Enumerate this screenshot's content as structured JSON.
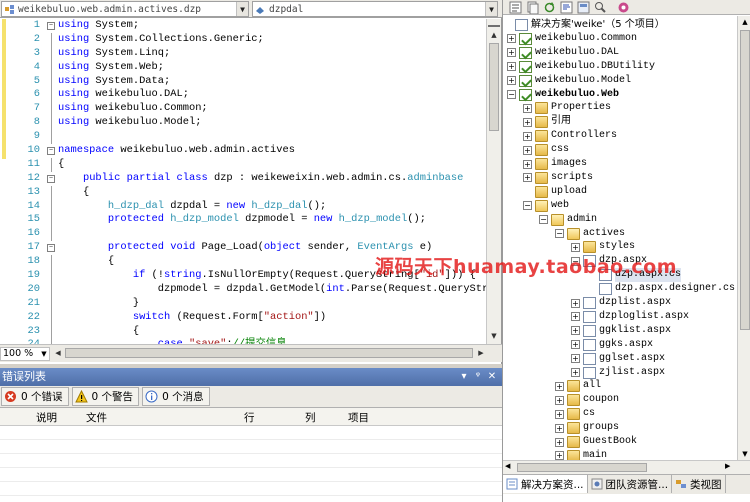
{
  "editor": {
    "class_combo": "weikebuluo.web.admin.actives.dzp",
    "member_combo": "dzpdal",
    "zoom": "100 %",
    "lines": [
      {
        "n": "1",
        "fold": "−",
        "html": "<span class='kw'>using</span> System;"
      },
      {
        "n": "2",
        "fold": "",
        "html": "<span class='kw'>using</span> System.Collections.Generic;"
      },
      {
        "n": "3",
        "fold": "",
        "html": "<span class='kw'>using</span> System.Linq;"
      },
      {
        "n": "4",
        "fold": "",
        "html": "<span class='kw'>using</span> System.Web;"
      },
      {
        "n": "5",
        "fold": "",
        "html": "<span class='kw'>using</span> System.Data;"
      },
      {
        "n": "6",
        "fold": "",
        "html": "<span class='kw'>using</span> weikebuluo.DAL;"
      },
      {
        "n": "7",
        "fold": "",
        "html": "<span class='kw'>using</span> weikebuluo.Common;"
      },
      {
        "n": "8",
        "fold": "",
        "html": "<span class='kw'>using</span> weikebuluo.Model;"
      },
      {
        "n": "9",
        "fold": "",
        "html": ""
      },
      {
        "n": "10",
        "fold": "−",
        "html": "<span class='kw'>namespace</span> weikebuluo.web.admin.actives"
      },
      {
        "n": "11",
        "fold": "",
        "html": "{"
      },
      {
        "n": "12",
        "fold": "−",
        "html": "    <span class='kw'>public</span> <span class='kw'>partial</span> <span class='kw'>class</span> dzp : weikeweixin.web.admin.cs.<span class='ty'>adminbase</span>"
      },
      {
        "n": "13",
        "fold": "",
        "html": "    {"
      },
      {
        "n": "14",
        "fold": "",
        "html": "        <span class='ty'>h_dzp_dal</span> dzpdal = <span class='kw'>new</span> <span class='ty'>h_dzp_dal</span>();"
      },
      {
        "n": "15",
        "fold": "",
        "html": "        <span class='kw'>protected</span> <span class='ty'>h_dzp_model</span> dzpmodel = <span class='kw'>new</span> <span class='ty'>h_dzp_model</span>();"
      },
      {
        "n": "16",
        "fold": "",
        "html": ""
      },
      {
        "n": "17",
        "fold": "−",
        "html": "        <span class='kw'>protected</span> <span class='kw'>void</span> Page_Load(<span class='kw'>object</span> sender, <span class='ty'>EventArgs</span> e)"
      },
      {
        "n": "18",
        "fold": "",
        "html": "        {"
      },
      {
        "n": "19",
        "fold": "",
        "html": "            <span class='kw'>if</span> (!<span class='kw'>string</span>.IsNullOrEmpty(Request.QueryString[<span class='st'>\"id\"</span>])) {"
      },
      {
        "n": "20",
        "fold": "",
        "html": "                dzpmodel = dzpdal.GetModel(<span class='kw'>int</span>.Parse(Request.QueryStri"
      },
      {
        "n": "21",
        "fold": "",
        "html": "            }"
      },
      {
        "n": "22",
        "fold": "",
        "html": "            <span class='kw'>switch</span> (Request.Form[<span class='st'>\"action\"</span>])"
      },
      {
        "n": "23",
        "fold": "",
        "html": "            {"
      },
      {
        "n": "24",
        "fold": "",
        "html": "                <span class='kw'>case</span> <span class='st'>\"save\"</span>:<span class='cm'>//提交信息</span>"
      }
    ]
  },
  "error_list": {
    "title": "错误列表",
    "tabs": [
      {
        "label": "0 个错误",
        "icon": "error-icon"
      },
      {
        "label": "0 个警告",
        "icon": "warning-icon"
      },
      {
        "label": "0 个消息",
        "icon": "info-icon"
      }
    ],
    "columns": [
      "说明",
      "文件",
      "行",
      "列",
      "项目"
    ]
  },
  "solution": {
    "nodes": [
      {
        "label": "解决方案'weike'（5 个项目）",
        "indent": 0,
        "exp": "",
        "icon": "solution",
        "bold": false
      },
      {
        "label": "weikebuluo.Common",
        "indent": 1,
        "exp": "+",
        "icon": "proj"
      },
      {
        "label": "weikebuluo.DAL",
        "indent": 1,
        "exp": "+",
        "icon": "proj"
      },
      {
        "label": "weikebuluo.DBUtility",
        "indent": 1,
        "exp": "+",
        "icon": "proj"
      },
      {
        "label": "weikebuluo.Model",
        "indent": 1,
        "exp": "+",
        "icon": "proj"
      },
      {
        "label": "weikebuluo.Web",
        "indent": 1,
        "exp": "−",
        "icon": "web",
        "bold": true
      },
      {
        "label": "Properties",
        "indent": 2,
        "exp": "+",
        "icon": "folder"
      },
      {
        "label": "引用",
        "indent": 2,
        "exp": "+",
        "icon": "folder"
      },
      {
        "label": "Controllers",
        "indent": 2,
        "exp": "+",
        "icon": "folder"
      },
      {
        "label": "css",
        "indent": 2,
        "exp": "+",
        "icon": "folder"
      },
      {
        "label": "images",
        "indent": 2,
        "exp": "+",
        "icon": "folder"
      },
      {
        "label": "scripts",
        "indent": 2,
        "exp": "+",
        "icon": "folder"
      },
      {
        "label": "upload",
        "indent": 2,
        "exp": "",
        "icon": "folder"
      },
      {
        "label": "web",
        "indent": 2,
        "exp": "−",
        "icon": "folder-open"
      },
      {
        "label": "admin",
        "indent": 3,
        "exp": "−",
        "icon": "folder-open"
      },
      {
        "label": "actives",
        "indent": 4,
        "exp": "−",
        "icon": "folder-open"
      },
      {
        "label": "styles",
        "indent": 5,
        "exp": "+",
        "icon": "folder"
      },
      {
        "label": "dzp.aspx",
        "indent": 5,
        "exp": "−",
        "icon": "file"
      },
      {
        "label": "dzp.aspx.cs",
        "indent": 6,
        "exp": "",
        "icon": "file",
        "selected": true
      },
      {
        "label": "dzp.aspx.designer.cs",
        "indent": 6,
        "exp": "",
        "icon": "file"
      },
      {
        "label": "dzplist.aspx",
        "indent": 5,
        "exp": "+",
        "icon": "file"
      },
      {
        "label": "dzploglist.aspx",
        "indent": 5,
        "exp": "+",
        "icon": "file"
      },
      {
        "label": "ggklist.aspx",
        "indent": 5,
        "exp": "+",
        "icon": "file"
      },
      {
        "label": "ggks.aspx",
        "indent": 5,
        "exp": "+",
        "icon": "file"
      },
      {
        "label": "gglset.aspx",
        "indent": 5,
        "exp": "+",
        "icon": "file"
      },
      {
        "label": "zjlist.aspx",
        "indent": 5,
        "exp": "+",
        "icon": "file"
      },
      {
        "label": "all",
        "indent": 4,
        "exp": "+",
        "icon": "folder"
      },
      {
        "label": "coupon",
        "indent": 4,
        "exp": "+",
        "icon": "folder"
      },
      {
        "label": "cs",
        "indent": 4,
        "exp": "+",
        "icon": "folder"
      },
      {
        "label": "groups",
        "indent": 4,
        "exp": "+",
        "icon": "folder"
      },
      {
        "label": "GuestBook",
        "indent": 4,
        "exp": "+",
        "icon": "folder"
      },
      {
        "label": "main",
        "indent": 4,
        "exp": "+",
        "icon": "folder"
      }
    ],
    "tabs": [
      {
        "label": "解决方案资...",
        "active": true
      },
      {
        "label": "团队资源管...",
        "active": false
      },
      {
        "label": "类视图",
        "active": false
      }
    ]
  },
  "watermark": "源码天下huamay.taobao.com",
  "colors": {
    "keyword": "#0000ff",
    "type": "#2b91af",
    "string": "#a31515",
    "comment": "#008000",
    "titlebar": "#5a7bb6",
    "watermark": "#e41b1b"
  }
}
